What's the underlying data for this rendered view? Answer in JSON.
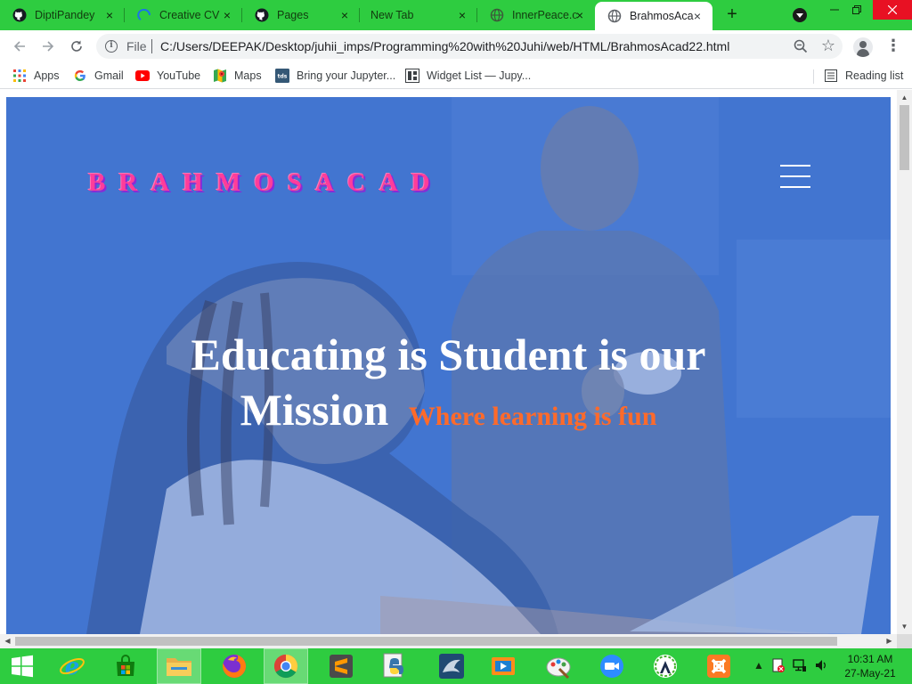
{
  "browser": {
    "tabs": [
      {
        "title": "DiptiPandey",
        "icon": "github-icon",
        "active": false
      },
      {
        "title": "Creative CV",
        "icon": "loading-spinner-icon",
        "active": false
      },
      {
        "title": "Pages",
        "icon": "github-icon",
        "active": false
      },
      {
        "title": "New Tab",
        "icon": "none",
        "active": false
      },
      {
        "title": "InnerPeace.c",
        "icon": "globe-icon",
        "active": false
      },
      {
        "title": "BrahmosAca",
        "icon": "globe-icon",
        "active": true
      }
    ],
    "new_tab_label": "+",
    "close_label": "×",
    "address": {
      "scheme_label": "File",
      "url": "C:/Users/DEEPAK/Desktop/juhii_imps/Programming%20with%20Juhi/web/HTML/BrahmosAcad22.html"
    },
    "bookmarks": [
      {
        "label": "Apps",
        "icon": "apps-grid-icon"
      },
      {
        "label": "Gmail",
        "icon": "google-icon"
      },
      {
        "label": "YouTube",
        "icon": "youtube-icon"
      },
      {
        "label": "Maps",
        "icon": "maps-icon"
      },
      {
        "label": "Bring your Jupyter...",
        "icon": "tds-icon"
      },
      {
        "label": "Widget List — Jupy...",
        "icon": "widget-icon"
      }
    ],
    "reading_list_label": "Reading list",
    "tds_badge": "tds",
    "colors": {
      "frame": "#2ecc40",
      "accent_close": "#e81123"
    }
  },
  "page": {
    "logo": "BRAHMOSACAD",
    "headline_line1": "Educating is Student is our",
    "headline_line2": "Mission",
    "tagline": "Where learning is fun",
    "colors": {
      "logo": "#ff3d9a",
      "tagline": "#ff6a2a",
      "hero_tint": "#4776cb"
    }
  },
  "taskbar": {
    "apps": [
      "start-icon",
      "internet-explorer-icon",
      "store-icon",
      "file-explorer-icon",
      "firefox-icon",
      "chrome-icon",
      "sublime-text-icon",
      "python-icon",
      "mysql-workbench-icon",
      "media-player-icon",
      "paint-icon",
      "zoom-icon",
      "anaconda-icon",
      "xampp-icon"
    ],
    "time": "10:31 AM",
    "date": "27-May-21"
  }
}
